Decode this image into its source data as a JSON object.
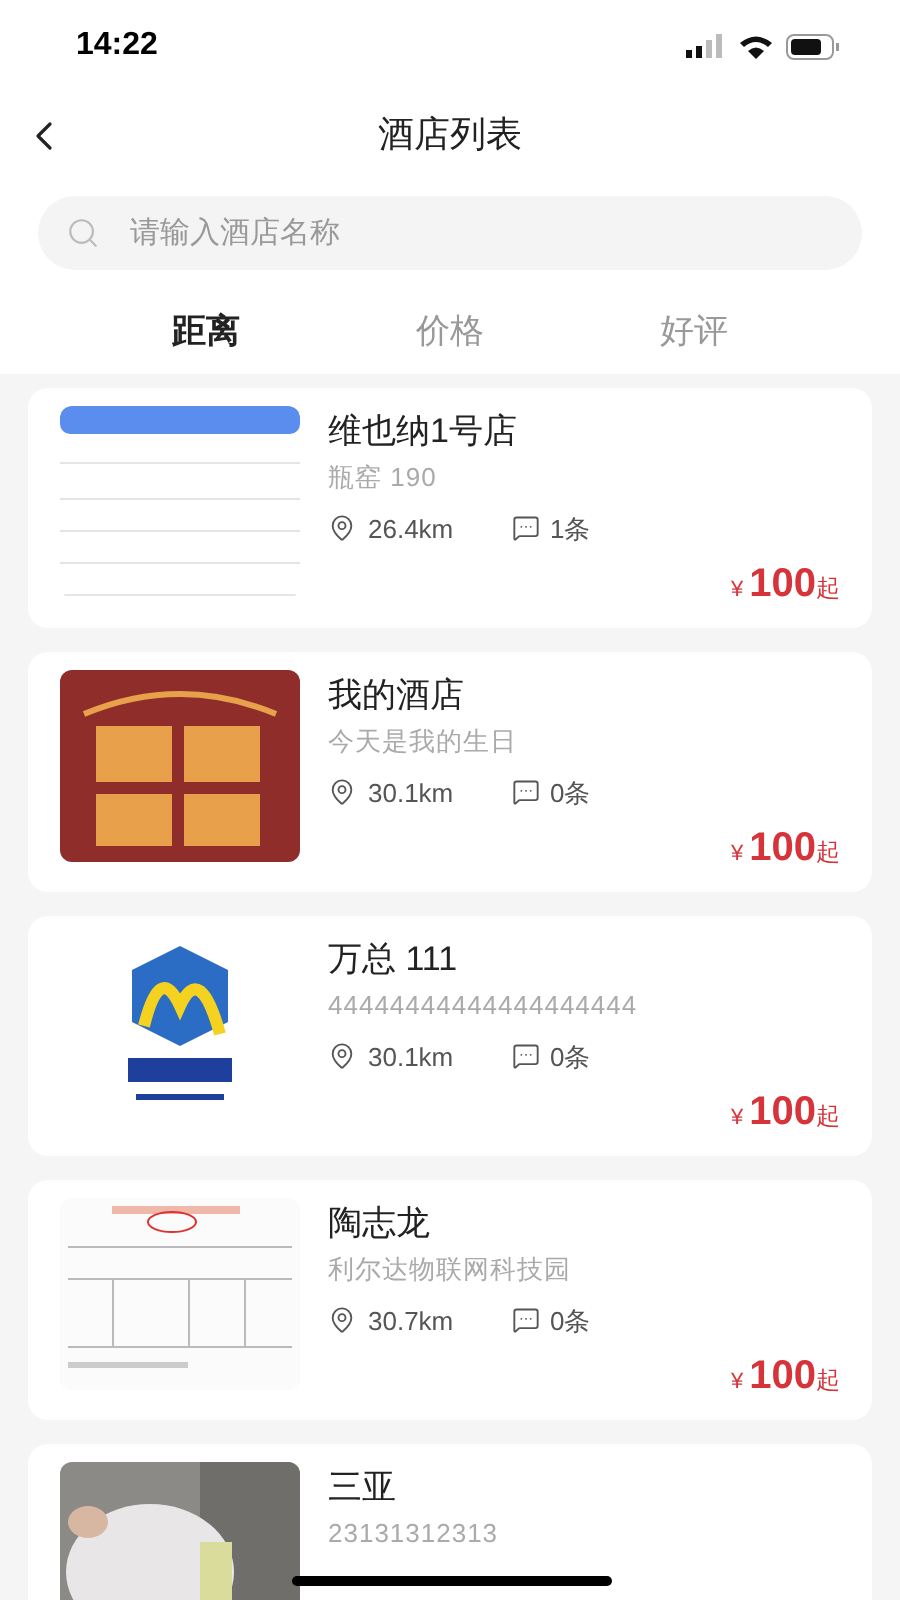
{
  "status_bar": {
    "time": "14:22"
  },
  "header": {
    "title": "酒店列表"
  },
  "search": {
    "placeholder": "请输入酒店名称"
  },
  "tabs": [
    {
      "label": "距离",
      "selected": true
    },
    {
      "label": "价格",
      "selected": false
    },
    {
      "label": "好评",
      "selected": false
    }
  ],
  "hotels": [
    {
      "name": "维也纳1号店",
      "address": "瓶窑 190",
      "distance": "26.4km",
      "reviews": "1条",
      "currency": "¥",
      "price": "100",
      "suffix": "起"
    },
    {
      "name": "我的酒店",
      "address": "今天是我的生日",
      "distance": "30.1km",
      "reviews": "0条",
      "currency": "¥",
      "price": "100",
      "suffix": "起"
    },
    {
      "name": "万总 111",
      "address": "44444444444444444444",
      "distance": "30.1km",
      "reviews": "0条",
      "currency": "¥",
      "price": "100",
      "suffix": "起"
    },
    {
      "name": "陶志龙",
      "address": "利尔达物联网科技园",
      "distance": "30.7km",
      "reviews": "0条",
      "currency": "¥",
      "price": "100",
      "suffix": "起"
    },
    {
      "name": "三亚",
      "address": "23131312313"
    }
  ]
}
